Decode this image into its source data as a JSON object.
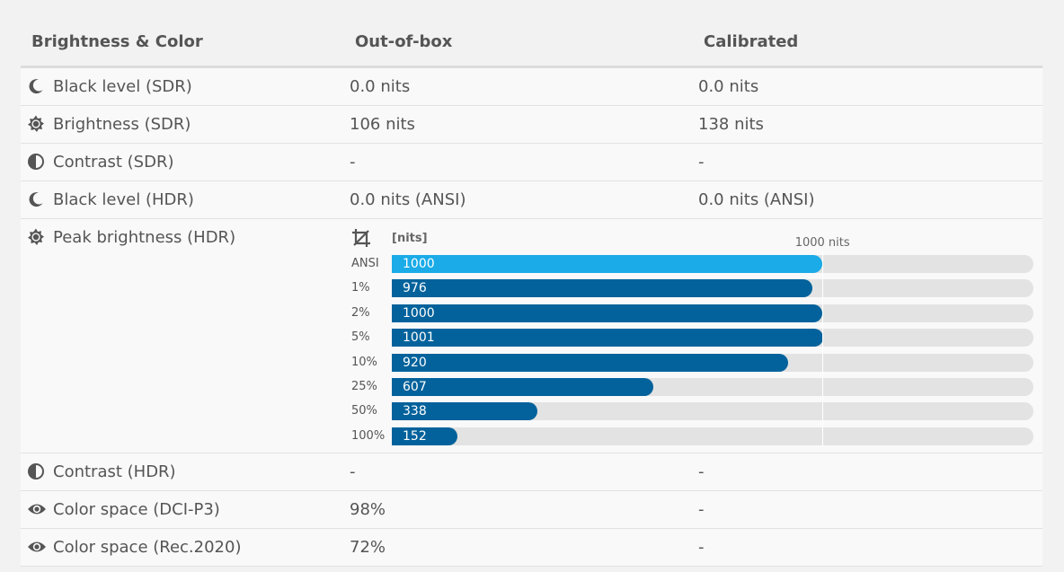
{
  "header": {
    "col_label": "Brightness & Color",
    "col_out": "Out-of-box",
    "col_cal": "Calibrated"
  },
  "rows": [
    {
      "icon": "moon-icon",
      "label": "Black level (SDR)",
      "out": "0.0 nits",
      "cal": "0.0 nits"
    },
    {
      "icon": "sun-icon",
      "label": "Brightness (SDR)",
      "out": "106 nits",
      "cal": "138 nits"
    },
    {
      "icon": "contrast-icon",
      "label": "Contrast (SDR)",
      "out": "-",
      "cal": "-"
    },
    {
      "icon": "moon-icon",
      "label": "Black level (HDR)",
      "out": "0.0 nits (ANSI)",
      "cal": "0.0 nits (ANSI)"
    },
    {
      "icon": "sun-icon",
      "label": "Peak brightness (HDR)",
      "chart": true
    },
    {
      "icon": "contrast-icon",
      "label": "Contrast (HDR)",
      "out": "-",
      "cal": "-"
    },
    {
      "icon": "eye-icon",
      "label": "Color space (DCI-P3)",
      "out": "98%",
      "cal": "-"
    },
    {
      "icon": "eye-icon",
      "label": "Color space (Rec.2020)",
      "out": "72%",
      "cal": "-"
    }
  ],
  "chart_data": {
    "type": "bar",
    "orientation": "horizontal",
    "unit_label": "[nits]",
    "reference_label": "1000 nits",
    "reference_value": 1000,
    "xlim": [
      0,
      1490
    ],
    "categories": [
      "ANSI",
      "1%",
      "2%",
      "5%",
      "10%",
      "25%",
      "50%",
      "100%"
    ],
    "values": [
      1000,
      976,
      1000,
      1001,
      920,
      607,
      338,
      152
    ],
    "highlight_index": 0,
    "colors": {
      "highlight": "#1aabe8",
      "bar": "#03629b",
      "track": "#e3e3e3"
    }
  }
}
